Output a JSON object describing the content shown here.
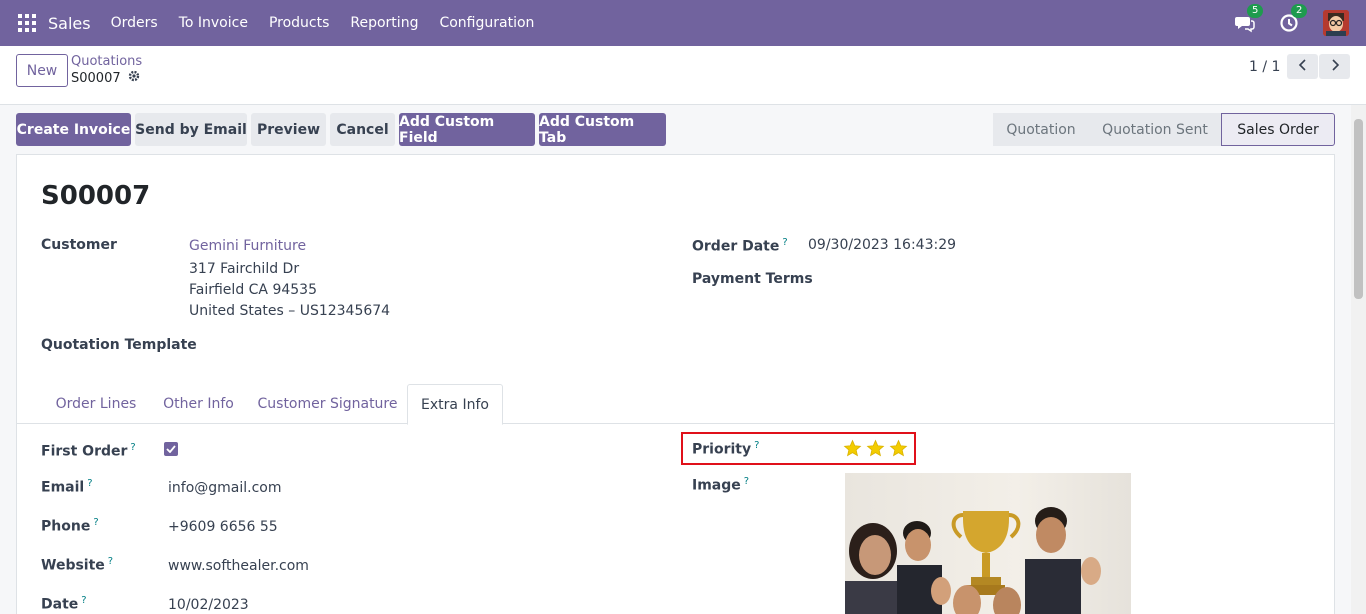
{
  "navbar": {
    "app_name": "Sales",
    "menu": [
      "Orders",
      "To Invoice",
      "Products",
      "Reporting",
      "Configuration"
    ],
    "messages_count": "5",
    "activities_count": "2",
    "icons": [
      "apps-grid-icon",
      "chat-icon",
      "clock-icon",
      "user-avatar"
    ]
  },
  "control_panel": {
    "new_label": "New",
    "breadcrumb_parent": "Quotations",
    "breadcrumb_current": "S00007",
    "pager": "1 / 1"
  },
  "actions": {
    "create_invoice": "Create Invoice",
    "send_by_email": "Send by Email",
    "preview": "Preview",
    "cancel": "Cancel",
    "add_custom_field": "Add Custom Field",
    "add_custom_tab": "Add Custom Tab"
  },
  "status_stages": [
    "Quotation",
    "Quotation Sent",
    "Sales Order"
  ],
  "active_stage": "Sales Order",
  "record": {
    "name": "S00007",
    "customer_label": "Customer",
    "customer_name": "Gemini Furniture",
    "address_line1": "317 Fairchild Dr",
    "address_line2": "Fairfield CA 94535",
    "address_line3": "United States – US12345674",
    "quotation_template_label": "Quotation Template",
    "order_date_label": "Order Date",
    "order_date_help": "?",
    "order_date": "09/30/2023 16:43:29",
    "payment_terms_label": "Payment Terms"
  },
  "tabs": [
    "Order Lines",
    "Other Info",
    "Customer Signature",
    "Extra Info"
  ],
  "active_tab": "Extra Info",
  "extra_info": {
    "help_mark": "?",
    "first_order_label": "First Order",
    "first_order_checked": true,
    "email_label": "Email",
    "email": "info@gmail.com",
    "phone_label": "Phone",
    "phone": "+9609 6656 55",
    "website_label": "Website",
    "website": "www.softhealer.com",
    "date_label": "Date",
    "date": "10/02/2023",
    "priority_label": "Priority",
    "priority_stars": 3,
    "priority_max": 3,
    "image_label": "Image"
  },
  "colors": {
    "brand": "#71639e",
    "star": "#f3cc00",
    "highlight": "#e0101a",
    "badge": "#1e9b4e"
  }
}
